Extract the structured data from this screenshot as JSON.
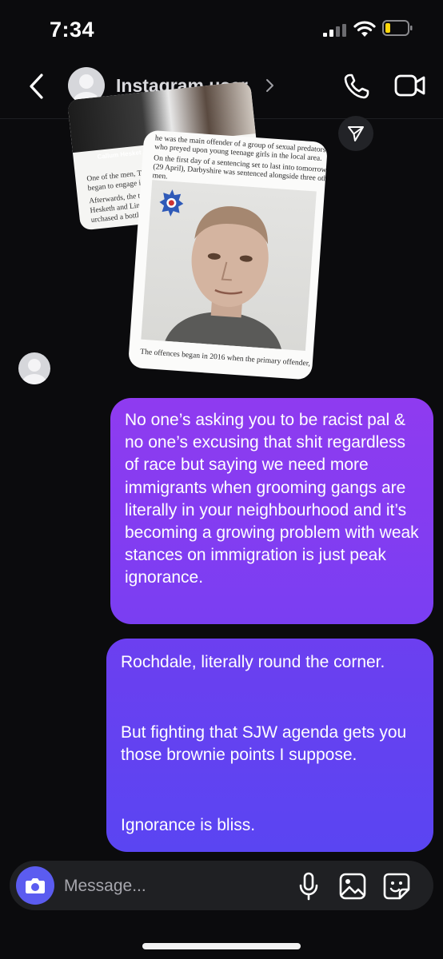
{
  "status_bar": {
    "time": "7:34"
  },
  "header": {
    "username": "Instagram user"
  },
  "shared_post": {
    "back_card": {
      "caption": "Callum Hesket",
      "lines": [
        "One of the men, Tho",
        "began to engage in",
        "Afterwards, the tw",
        "Hesketh and Linfo",
        "urchased a bottle"
      ]
    },
    "front_card": {
      "top_lines": [
        "he was the main offender of a group of sexual predators",
        "who preyed upon young teenage girls in the local area.",
        "On the first day of a sentencing set to last into tomorrow",
        "(29 April), Darbyshire was sentenced alongside three other",
        "men."
      ],
      "bottom_lines": [
        "The offences began in 2016 when the primary offender,"
      ]
    }
  },
  "messages": [
    {
      "from": "me",
      "text": "No one’s asking you to be racist pal & no one’s excusing that shit regardless of race but saying we need more immigrants when grooming gangs are literally in your neighbourhood and it’s becoming a growing problem with weak stances on immigration is just peak ignorance."
    },
    {
      "from": "me",
      "paragraphs": [
        "Rochdale, literally round the corner.",
        "But fighting that SJW agenda gets you those brownie points I suppose.",
        "Ignorance is bliss."
      ]
    }
  ],
  "composer": {
    "placeholder": "Message..."
  },
  "colors": {
    "bubble_top": "#8f3bf0",
    "bubble_bottom": "#5a45f2",
    "camera_button": "#5b5cf0",
    "background": "#0b0b0d"
  }
}
